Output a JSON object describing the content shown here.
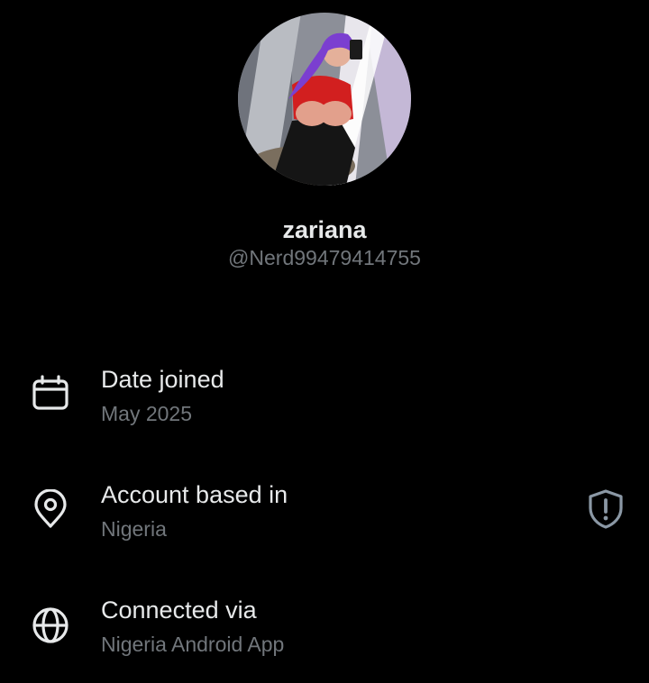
{
  "profile": {
    "display_name": "zariana",
    "handle": "@Nerd99479414755",
    "avatar_icon": "profile-photo"
  },
  "about": {
    "items": [
      {
        "icon": "calendar-icon",
        "title": "Date joined",
        "value": "May 2025"
      },
      {
        "icon": "location-pin-icon",
        "title": "Account based in",
        "value": "Nigeria",
        "badge_icon": "shield-alert-icon"
      },
      {
        "icon": "globe-icon",
        "title": "Connected via",
        "value": "Nigeria Android App"
      }
    ]
  },
  "colors": {
    "background": "#000000",
    "primary_text": "#e7e9ea",
    "secondary_text": "#71767b"
  }
}
